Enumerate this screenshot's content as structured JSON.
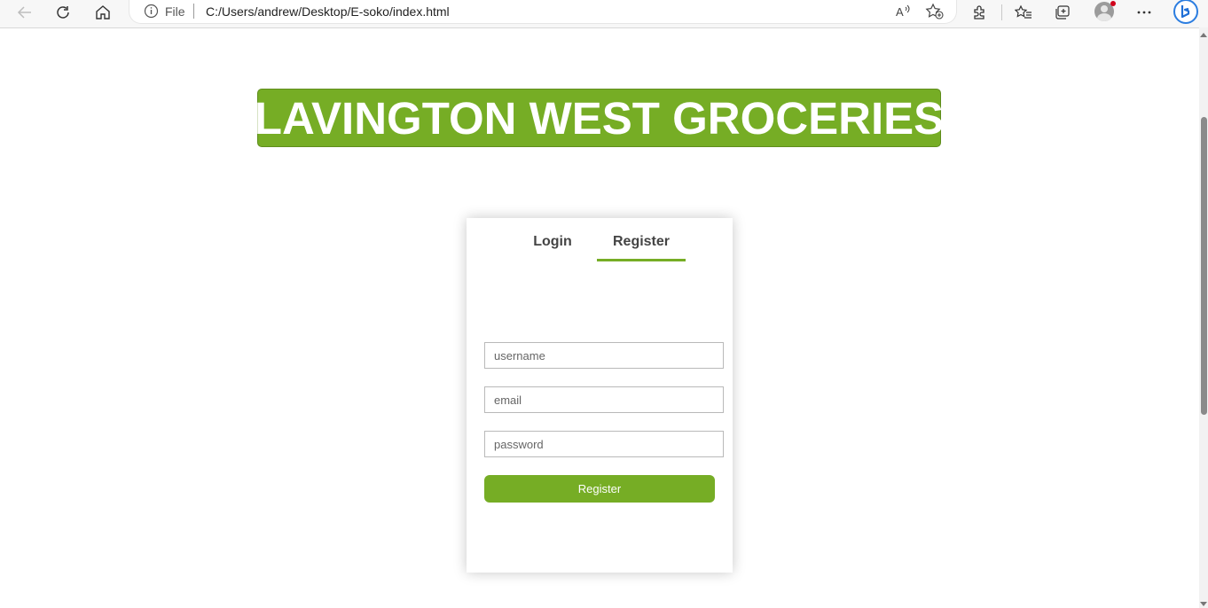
{
  "browser": {
    "file_label": "File",
    "url": "C:/Users/andrew/Desktop/E-soko/index.html",
    "icons": [
      "back-arrow-icon",
      "refresh-icon",
      "home-icon",
      "info-icon",
      "read-aloud-icon",
      "add-favorite-icon",
      "extensions-icon",
      "favorites-icon",
      "collections-icon",
      "profile-avatar",
      "more-icon",
      "copilot-icon"
    ]
  },
  "page": {
    "title": "LAVINGTON WEST GROCERIES",
    "accent_color": "#76ad25"
  },
  "form": {
    "tabs": [
      {
        "label": "Login",
        "active": false
      },
      {
        "label": "Register",
        "active": true
      }
    ],
    "username_placeholder": "username",
    "email_placeholder": "email",
    "password_placeholder": "password",
    "submit_label": "Register"
  }
}
